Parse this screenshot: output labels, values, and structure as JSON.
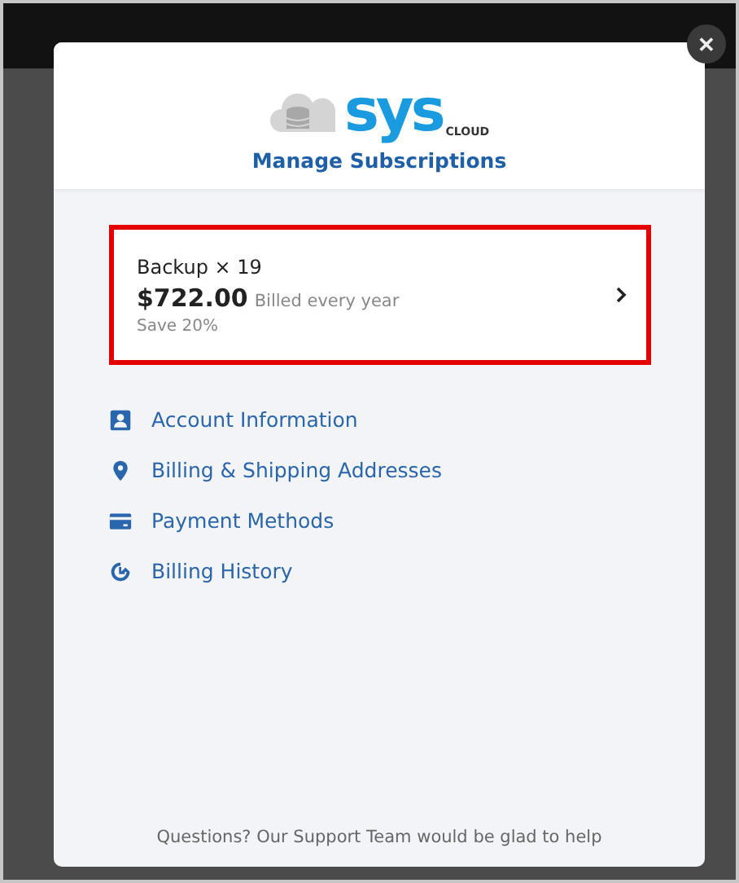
{
  "logo": {
    "wordmark": "sys",
    "subtitle": "CLOUD"
  },
  "title": "Manage Subscriptions",
  "close": {
    "glyph": "✕"
  },
  "subscription": {
    "product": "Backup × 19",
    "price": "$722.00",
    "billing": "Billed every year",
    "savings": "Save 20%",
    "selected": true
  },
  "menu": [
    {
      "kind": "account",
      "label": "Account Information"
    },
    {
      "kind": "address",
      "label": "Billing & Shipping Addresses"
    },
    {
      "kind": "payment",
      "label": "Payment Methods"
    },
    {
      "kind": "history",
      "label": "Billing History"
    }
  ],
  "footer": "Questions? Our Support Team would be glad to help"
}
